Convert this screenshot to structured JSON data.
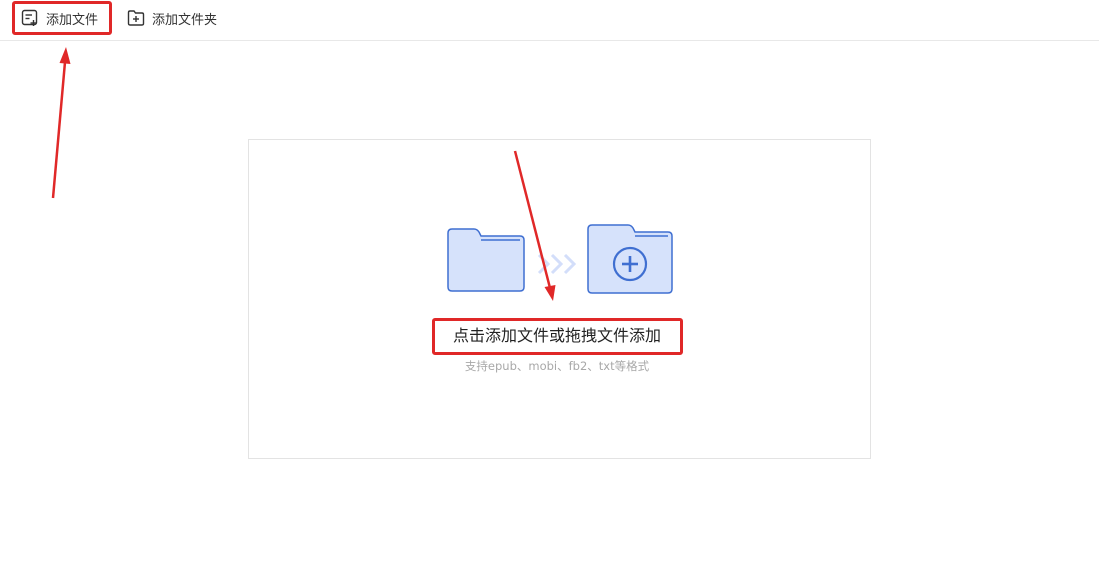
{
  "toolbar": {
    "add_file_label": "添加文件",
    "add_folder_label": "添加文件夹"
  },
  "dropzone": {
    "main_text": "点击添加文件或拖拽文件添加",
    "sub_text": "支持epub、mobi、fb2、txt等格式"
  },
  "icons": {
    "add_file": "file-add-icon",
    "add_folder": "folder-add-icon",
    "folder_plain": "folder-icon",
    "chevrons": "double-chevron-right-icon",
    "folder_plus": "folder-plus-icon"
  },
  "colors": {
    "highlight": "#e02828",
    "folder_fill": "#d6e2fb",
    "folder_stroke": "#3f6fd1",
    "chevron": "#d3defa"
  }
}
